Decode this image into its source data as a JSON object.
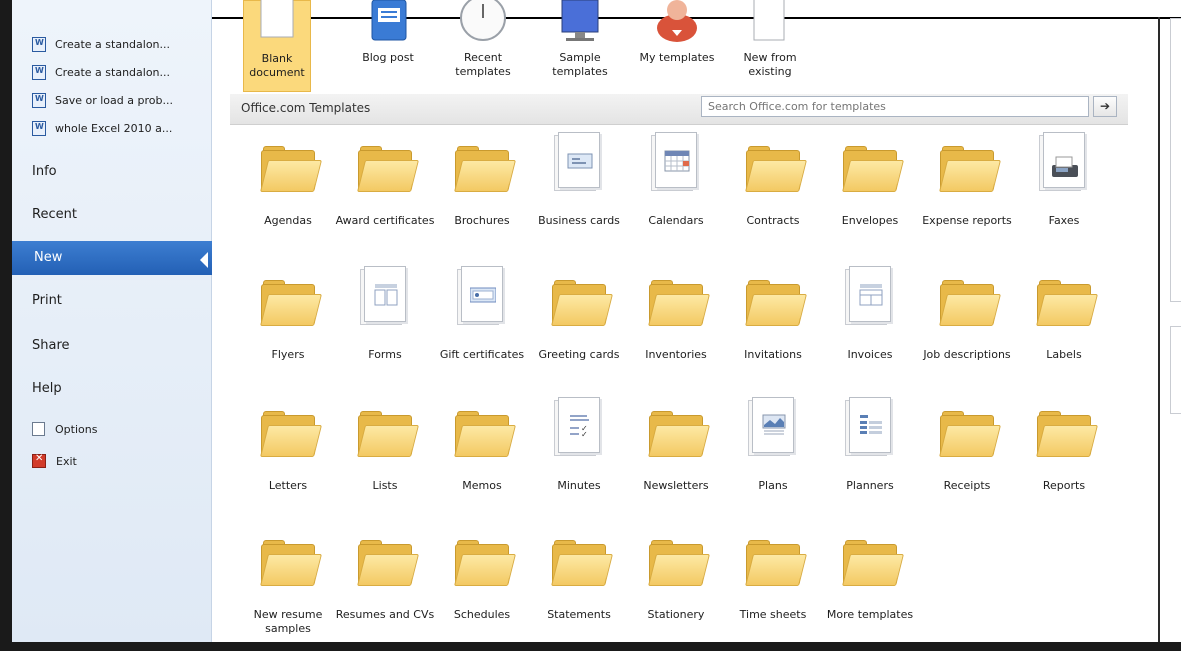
{
  "sidebar": {
    "recent_docs": [
      "Create a standalon...",
      "Create a standalon...",
      "Save or load a prob...",
      "whole Excel 2010 a..."
    ],
    "nav": {
      "info": "Info",
      "recent": "Recent",
      "new": "New",
      "print": "Print",
      "share": "Share",
      "help": "Help",
      "options": "Options",
      "exit": "Exit"
    }
  },
  "top_templates": [
    {
      "label": "Blank document",
      "icon": "blank-document-icon",
      "selected": true
    },
    {
      "label": "Blog post",
      "icon": "blog-post-icon"
    },
    {
      "label": "Recent templates",
      "icon": "clock-icon"
    },
    {
      "label": "Sample templates",
      "icon": "monitor-icon"
    },
    {
      "label": "My templates",
      "icon": "person-icon"
    },
    {
      "label": "New from existing",
      "icon": "document-icon"
    }
  ],
  "office": {
    "title": "Office.com Templates",
    "search_placeholder": "Search Office.com for templates",
    "go_glyph": "➔"
  },
  "categories": [
    {
      "label": "Agendas",
      "icon": "folder"
    },
    {
      "label": "Award certificates",
      "icon": "folder"
    },
    {
      "label": "Brochures",
      "icon": "folder"
    },
    {
      "label": "Business cards",
      "icon": "business-cards"
    },
    {
      "label": "Calendars",
      "icon": "calendar"
    },
    {
      "label": "Contracts",
      "icon": "folder"
    },
    {
      "label": "Envelopes",
      "icon": "folder"
    },
    {
      "label": "Expense reports",
      "icon": "folder"
    },
    {
      "label": "Faxes",
      "icon": "fax"
    },
    {
      "label": "Flyers",
      "icon": "folder"
    },
    {
      "label": "Forms",
      "icon": "form"
    },
    {
      "label": "Gift certificates",
      "icon": "gift-certificate"
    },
    {
      "label": "Greeting cards",
      "icon": "folder"
    },
    {
      "label": "Inventories",
      "icon": "folder"
    },
    {
      "label": "Invitations",
      "icon": "folder"
    },
    {
      "label": "Invoices",
      "icon": "invoice"
    },
    {
      "label": "Job descriptions",
      "icon": "folder"
    },
    {
      "label": "Labels",
      "icon": "folder"
    },
    {
      "label": "Letters",
      "icon": "folder"
    },
    {
      "label": "Lists",
      "icon": "folder"
    },
    {
      "label": "Memos",
      "icon": "folder"
    },
    {
      "label": "Minutes",
      "icon": "minutes"
    },
    {
      "label": "Newsletters",
      "icon": "folder"
    },
    {
      "label": "Plans",
      "icon": "plan"
    },
    {
      "label": "Planners",
      "icon": "planner"
    },
    {
      "label": "Receipts",
      "icon": "folder"
    },
    {
      "label": "Reports",
      "icon": "folder"
    },
    {
      "label": "New resume samples",
      "icon": "folder"
    },
    {
      "label": "Resumes and CVs",
      "icon": "folder"
    },
    {
      "label": "Schedules",
      "icon": "folder"
    },
    {
      "label": "Statements",
      "icon": "folder"
    },
    {
      "label": "Stationery",
      "icon": "folder"
    },
    {
      "label": "Time sheets",
      "icon": "folder"
    },
    {
      "label": "More templates",
      "icon": "folder"
    }
  ]
}
